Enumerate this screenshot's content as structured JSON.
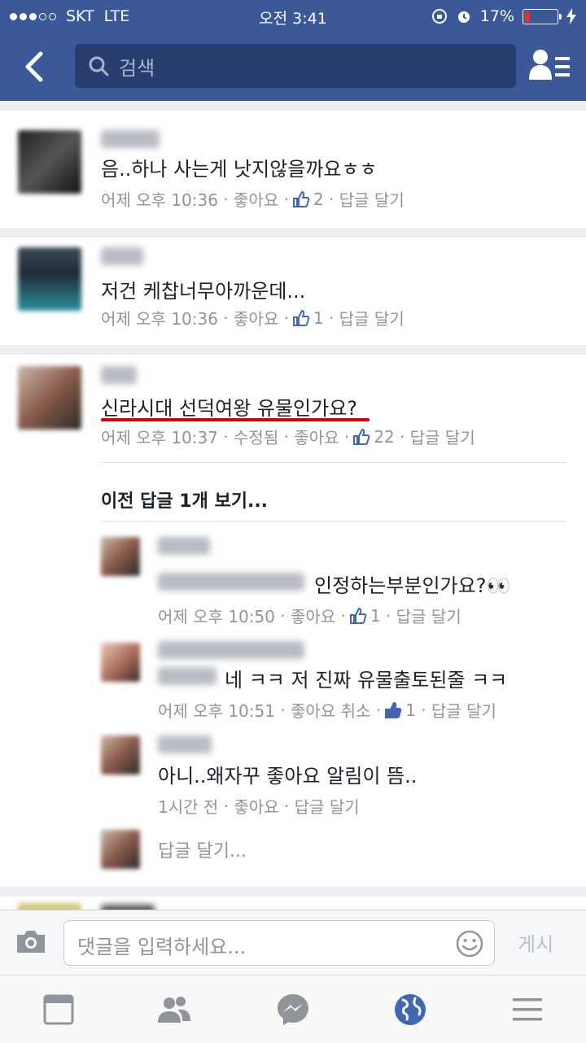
{
  "status_bar": {
    "carrier": "SKT",
    "network": "LTE",
    "time": "오전 3:41",
    "battery": "17%",
    "battery_level": 0.17
  },
  "nav": {
    "search_placeholder": "검색"
  },
  "comments": [
    {
      "text": "음..하나 사는게 낫지않을까요ㅎㅎ",
      "time": "어제 오후 10:36",
      "like": "좋아요",
      "likes": "2",
      "reply": "답글 달기"
    },
    {
      "text": "저건 케찹너무아까운데...",
      "time": "어제 오후 10:36",
      "like": "좋아요",
      "likes": "1",
      "reply": "답글 달기"
    },
    {
      "text": "신라시대 선덕여왕 유물인가요?",
      "time": "어제 오후 10:37",
      "edited": "수정됨",
      "like": "좋아요",
      "likes": "22",
      "reply": "답글 달기"
    }
  ],
  "view_previous_replies": "이전 답글 1개 보기...",
  "replies": [
    {
      "text": "인정하는부분인가요?👀",
      "time": "어제 오후 10:50",
      "like": "좋아요",
      "likes": "1",
      "reply": "답글 달기"
    },
    {
      "text": "네 ㅋㅋ 저 진짜 유물출토된줄 ㅋㅋ",
      "time": "어제 오후 10:51",
      "like": "좋아요 취소",
      "likes": "1",
      "reply": "답글 달기"
    },
    {
      "text": "아니..왜자꾸 좋아요 알림이 뜸..",
      "time": "1시간 전",
      "like": "좋아요",
      "reply": "답글 달기"
    }
  ],
  "reply_prompt": "답글 달기...",
  "comment_input": {
    "placeholder": "댓글을 입력하세요...",
    "post_label": "게시"
  },
  "colors": {
    "nav_blue": "#3b5998",
    "search_bg": "#283e6e",
    "highlight_red": "#d40000",
    "meta_gray": "#90949c"
  },
  "icons": [
    "back-arrow-icon",
    "search-icon",
    "friend-requests-icon",
    "like-icon",
    "camera-icon",
    "emoji-icon",
    "news-feed-icon",
    "friends-icon",
    "messenger-icon",
    "globe-icon",
    "menu-icon"
  ]
}
